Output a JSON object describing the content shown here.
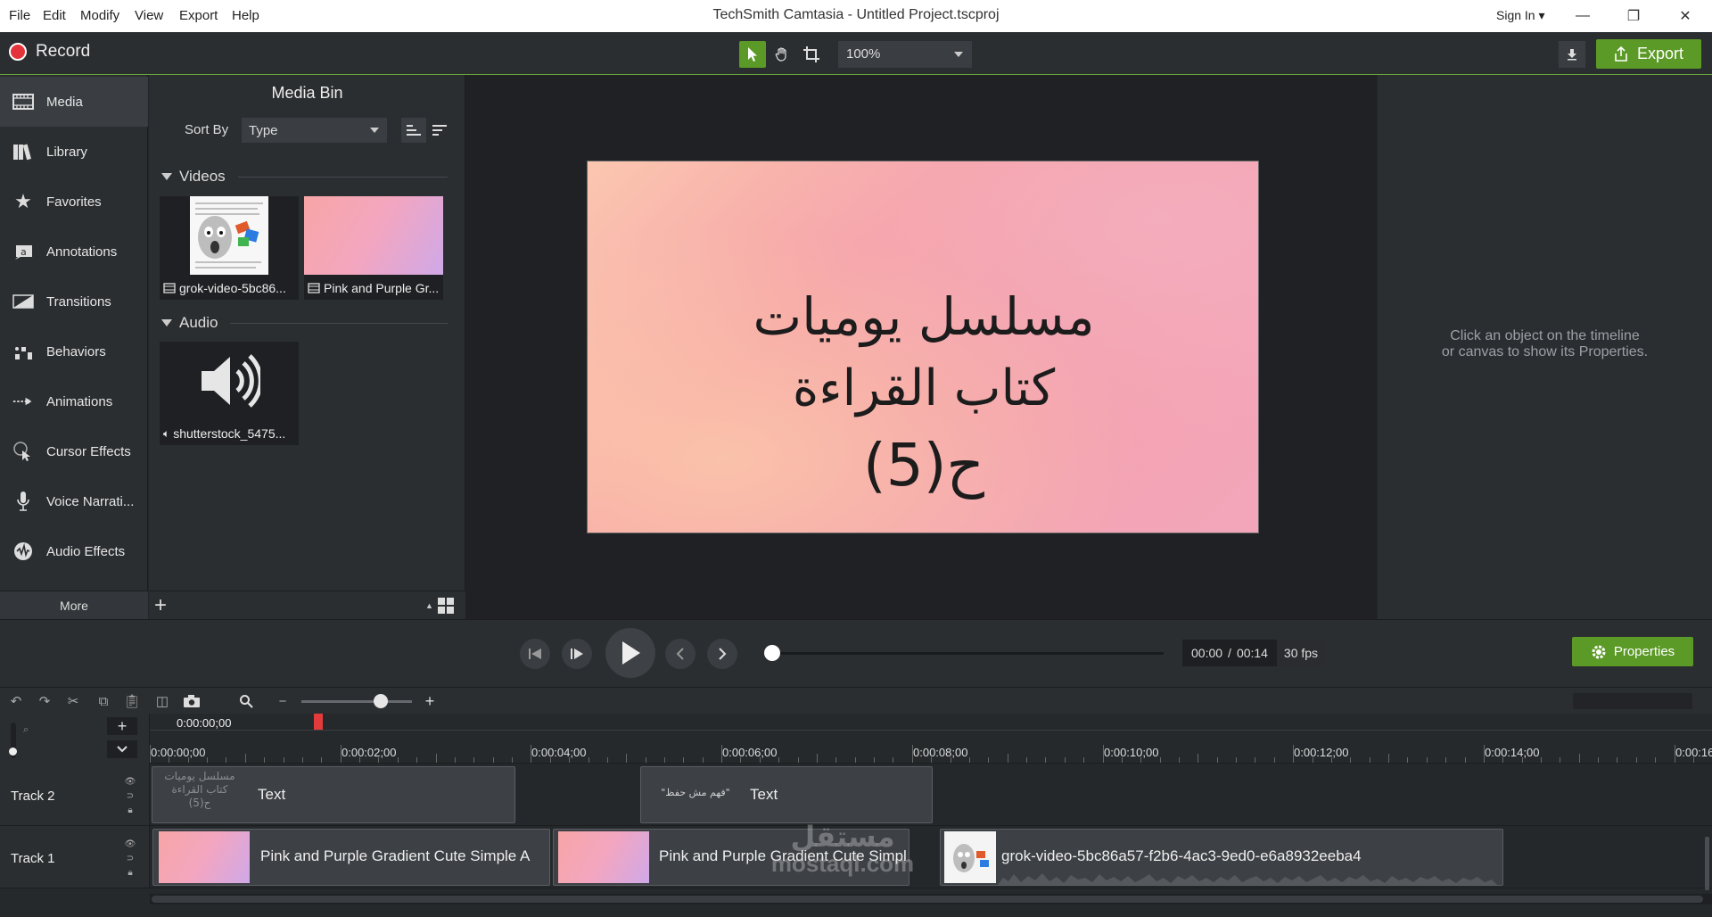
{
  "menubar": {
    "items": [
      "File",
      "Edit",
      "Modify",
      "View",
      "Export",
      "Help"
    ],
    "title": "TechSmith Camtasia - Untitled Project.tscproj",
    "signin": "Sign In"
  },
  "toolbar": {
    "record_label": "Record",
    "zoom_value": "100%",
    "export_label": "Export",
    "accent_color": "#5b9a26"
  },
  "sidebar": {
    "items": [
      {
        "label": "Media",
        "icon": "film-strip-icon"
      },
      {
        "label": "Library",
        "icon": "books-icon"
      },
      {
        "label": "Favorites",
        "icon": "star-icon"
      },
      {
        "label": "Annotations",
        "icon": "annotation-icon"
      },
      {
        "label": "Transitions",
        "icon": "transition-icon"
      },
      {
        "label": "Behaviors",
        "icon": "behaviors-icon"
      },
      {
        "label": "Animations",
        "icon": "animation-arrow-icon"
      },
      {
        "label": "Cursor Effects",
        "icon": "cursor-icon"
      },
      {
        "label": "Voice Narrati...",
        "icon": "microphone-icon"
      },
      {
        "label": "Audio Effects",
        "icon": "audio-effects-icon"
      }
    ],
    "more_label": "More"
  },
  "media_bin": {
    "title": "Media Bin",
    "sort_label": "Sort By",
    "sort_value": "Type",
    "videos_heading": "Videos",
    "audio_heading": "Audio",
    "videos": [
      {
        "label": "grok-video-5bc86..."
      },
      {
        "label": "Pink and Purple Gr..."
      }
    ],
    "audio": [
      {
        "label": "shutterstock_5475..."
      }
    ]
  },
  "canvas": {
    "lines": [
      "مسلسل يوميات",
      "كتاب القراءة",
      "ح(5)"
    ]
  },
  "properties": {
    "hint_line1": "Click an object on the timeline",
    "hint_line2": "or canvas to show its Properties."
  },
  "playback": {
    "current_time": "00:00",
    "separator": "/",
    "total_time": "00:14",
    "fps": "30 fps",
    "properties_label": "Properties"
  },
  "timeline": {
    "playhead_time": "0:00:00;00",
    "ruler_labels": [
      "0:00:00;00",
      "0:00:02;00",
      "0:00:04;00",
      "0:00:06;00",
      "0:00:08;00",
      "0:00:10;00",
      "0:00:12;00",
      "0:00:14;00",
      "0:00:16"
    ],
    "tracks": [
      {
        "name": "Track 2",
        "clips": [
          {
            "label": "Text",
            "thumb_text": [
              "مسلسل يوميات",
              "كتاب القراءة",
              "ح(5)"
            ]
          },
          {
            "label": "Text",
            "thumb_text": [
              "\"فهم مش حفظ\""
            ]
          }
        ]
      },
      {
        "name": "Track 1",
        "clips": [
          {
            "label": "Pink and Purple Gradient Cute Simple A"
          },
          {
            "label": "Pink and Purple Gradient Cute Simpl"
          },
          {
            "label": "grok-video-5bc86a57-f2b6-4ac3-9ed0-e6a8932eeba4"
          }
        ]
      }
    ]
  },
  "watermark": {
    "line1": "مستقل",
    "line2": "mostaql.com"
  }
}
